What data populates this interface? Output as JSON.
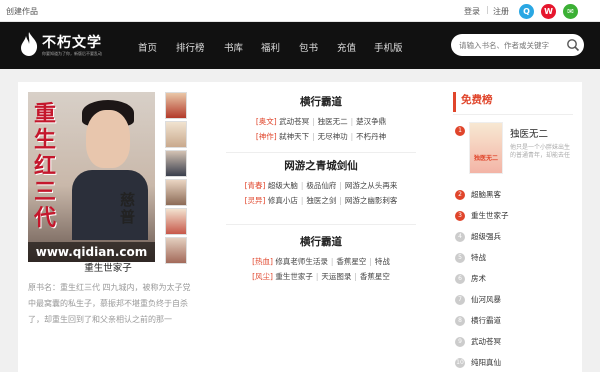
{
  "topbar": {
    "create": "创建作品",
    "login": "登录",
    "sep": "|",
    "register": "注册"
  },
  "nav": {
    "logo_title": "不朽文学",
    "logo_tagline": "你要知道为了你，新版后不要乱动",
    "items": [
      "首页",
      "排行榜",
      "书库",
      "福利",
      "包书",
      "充值",
      "手机版"
    ],
    "search_placeholder": "请输入书名、作者或关键字"
  },
  "feature": {
    "cover_title": "重生红三代",
    "cover_author": "慈普",
    "cover_watermark": "www.qidian.com",
    "book_name": "重生世家子",
    "description": "原书名：重生红三代 四九城内，被称为太子党中最窝囊的私生子，慕振邦不堪重负终于自杀了，却重生回到了和父亲相认之前的那一"
  },
  "middle": [
    {
      "heading": "横行霸道",
      "rows": [
        {
          "tag": "[奥文]",
          "items": [
            "武动苍冥",
            "独医无二",
            "楚汉争鼎"
          ]
        },
        {
          "tag": "[神作]",
          "items": [
            "弑神天下",
            "无尽神功",
            "不朽丹神"
          ]
        }
      ]
    },
    {
      "heading": "网游之青城剑仙",
      "rows": [
        {
          "tag": "[青春]",
          "items": [
            "超级大脑",
            "极品仙府",
            "网游之从头再来"
          ]
        },
        {
          "tag": "[灵异]",
          "items": [
            "修真小店",
            "独医之剑",
            "网游之幽影刺客"
          ]
        }
      ]
    },
    {
      "heading": "横行霸道",
      "rows": [
        {
          "tag": "[热血]",
          "items": [
            "修真老师生活录",
            "香蕉星空",
            "特战"
          ]
        },
        {
          "tag": "[风尘]",
          "items": [
            "重生世家子",
            "天运图录",
            "香蕉星空"
          ]
        }
      ]
    }
  ],
  "ranking": {
    "heading": "免费榜",
    "first": {
      "num": "1",
      "title": "独医无二",
      "cover_text": "独医无二",
      "desc": "他只是一个小胖妹出生的普通青年，却能去任"
    },
    "items": [
      {
        "num": "2",
        "title": "超脑黑客"
      },
      {
        "num": "3",
        "title": "重生世家子"
      },
      {
        "num": "4",
        "title": "超级强兵"
      },
      {
        "num": "5",
        "title": "特战"
      },
      {
        "num": "6",
        "title": "房术"
      },
      {
        "num": "7",
        "title": "仙河风暴"
      },
      {
        "num": "8",
        "title": "横行霸道"
      },
      {
        "num": "9",
        "title": "武动苍冥"
      },
      {
        "num": "10",
        "title": "纯阳真仙"
      }
    ]
  }
}
